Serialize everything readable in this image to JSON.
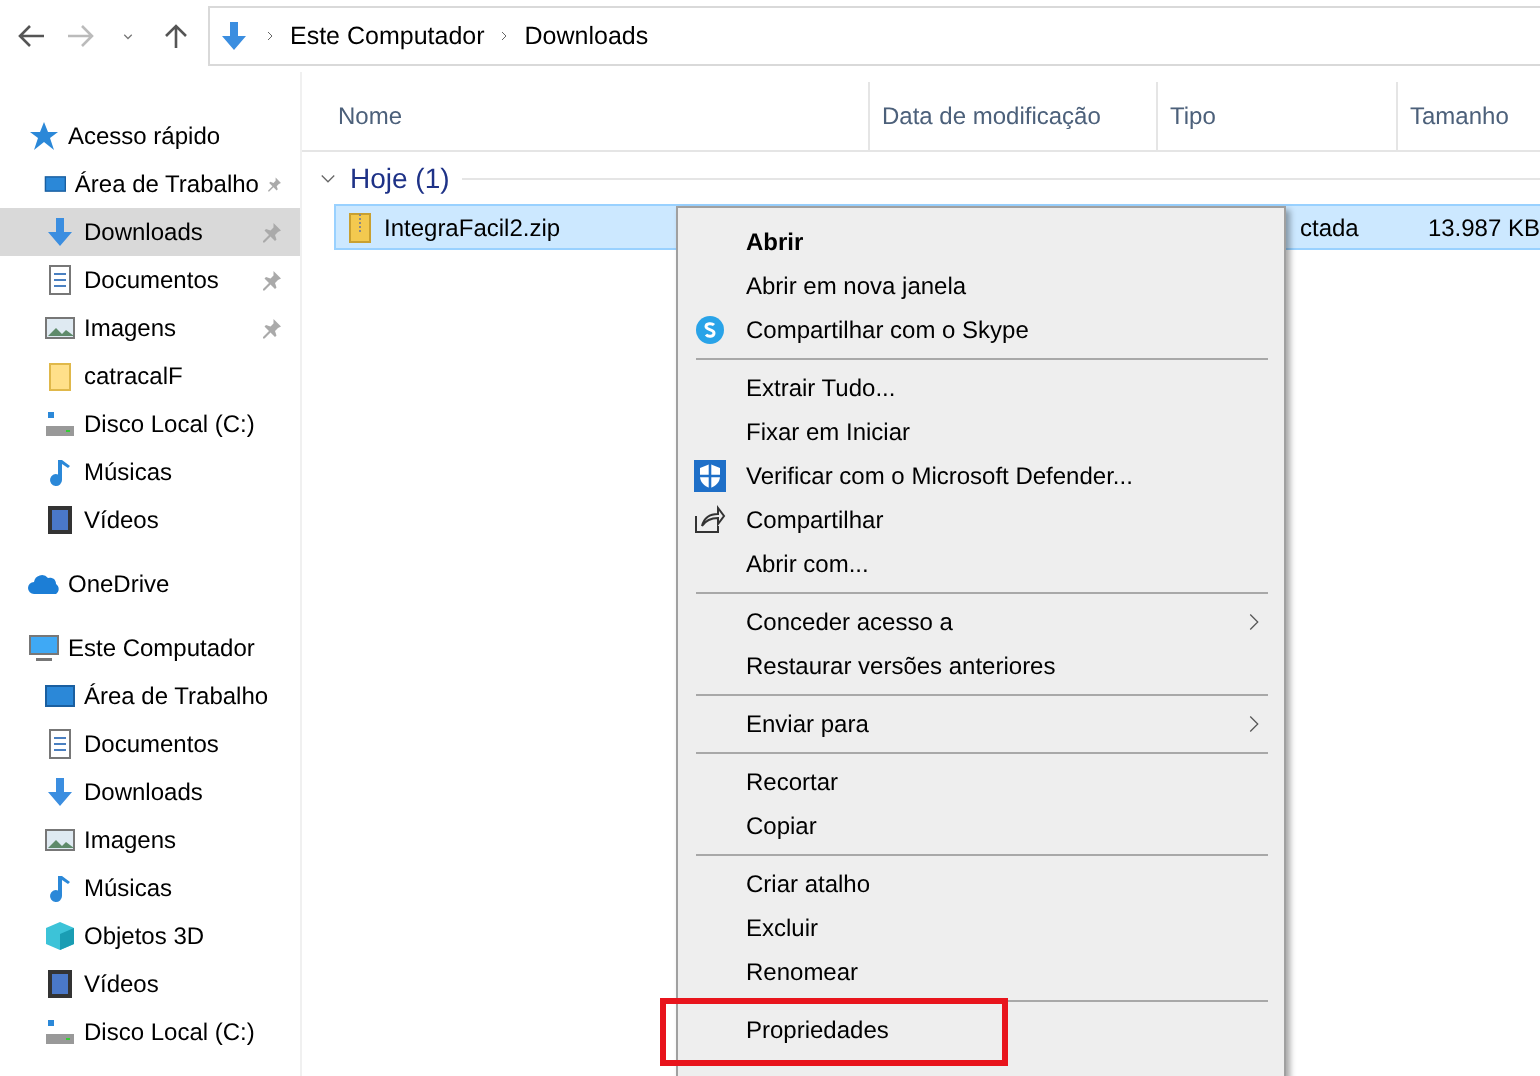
{
  "address_bar": {
    "path": [
      "Este Computador",
      "Downloads"
    ]
  },
  "sidebar": {
    "sections": [
      {
        "label": "Acesso rápido",
        "children": [
          {
            "label": "Área de Trabalho",
            "pinned": true,
            "selected": false
          },
          {
            "label": "Downloads",
            "pinned": true,
            "selected": true
          },
          {
            "label": "Documentos",
            "pinned": true,
            "selected": false
          },
          {
            "label": "Imagens",
            "pinned": true,
            "selected": false
          },
          {
            "label": "catracalF",
            "pinned": false,
            "selected": false
          },
          {
            "label": "Disco Local (C:)",
            "pinned": false,
            "selected": false
          },
          {
            "label": "Músicas",
            "pinned": false,
            "selected": false
          },
          {
            "label": "Vídeos",
            "pinned": false,
            "selected": false
          }
        ]
      },
      {
        "label": "OneDrive"
      },
      {
        "label": "Este Computador",
        "children": [
          {
            "label": "Área de Trabalho",
            "pinned": false,
            "selected": false
          },
          {
            "label": "Documentos",
            "pinned": false,
            "selected": false
          },
          {
            "label": "Downloads",
            "pinned": false,
            "selected": false
          },
          {
            "label": "Imagens",
            "pinned": false,
            "selected": false
          },
          {
            "label": "Músicas",
            "pinned": false,
            "selected": false
          },
          {
            "label": "Objetos 3D",
            "pinned": false,
            "selected": false
          },
          {
            "label": "Vídeos",
            "pinned": false,
            "selected": false
          },
          {
            "label": "Disco Local (C:)",
            "pinned": false,
            "selected": false
          }
        ]
      }
    ]
  },
  "file_list": {
    "columns": [
      "Nome",
      "Data de modificação",
      "Tipo",
      "Tamanho"
    ],
    "group": {
      "label": "Hoje (1)",
      "expanded": true
    },
    "rows": [
      {
        "name": "IntegraFacil2.zip",
        "type": "ctada",
        "size": "13.987 KB",
        "selected": true
      }
    ]
  },
  "context_menu": {
    "groups": [
      [
        {
          "label": "Abrir",
          "bold": true,
          "submenu": false,
          "highlighted": false
        },
        {
          "label": "Abrir em nova janela",
          "bold": false,
          "submenu": false,
          "highlighted": false
        },
        {
          "label": "Compartilhar com o Skype",
          "bold": false,
          "submenu": false,
          "highlighted": false
        }
      ],
      [
        {
          "label": "Extrair Tudo...",
          "bold": false,
          "submenu": false,
          "highlighted": false
        },
        {
          "label": "Fixar em Iniciar",
          "bold": false,
          "submenu": false,
          "highlighted": false
        },
        {
          "label": "Verificar com o Microsoft Defender...",
          "bold": false,
          "submenu": false,
          "highlighted": false
        },
        {
          "label": "Compartilhar",
          "bold": false,
          "submenu": false,
          "highlighted": false
        },
        {
          "label": "Abrir com...",
          "bold": false,
          "submenu": false,
          "highlighted": false
        }
      ],
      [
        {
          "label": "Conceder acesso a",
          "bold": false,
          "submenu": true,
          "highlighted": false
        },
        {
          "label": "Restaurar versões anteriores",
          "bold": false,
          "submenu": false,
          "highlighted": false
        }
      ],
      [
        {
          "label": "Enviar para",
          "bold": false,
          "submenu": true,
          "highlighted": false
        }
      ],
      [
        {
          "label": "Recortar",
          "bold": false,
          "submenu": false,
          "highlighted": false
        },
        {
          "label": "Copiar",
          "bold": false,
          "submenu": false,
          "highlighted": false
        }
      ],
      [
        {
          "label": "Criar atalho",
          "bold": false,
          "submenu": false,
          "highlighted": false
        },
        {
          "label": "Excluir",
          "bold": false,
          "submenu": false,
          "highlighted": false
        },
        {
          "label": "Renomear",
          "bold": false,
          "submenu": false,
          "highlighted": false
        }
      ],
      [
        {
          "label": "Propriedades",
          "bold": false,
          "submenu": false,
          "highlighted": true
        }
      ]
    ]
  }
}
